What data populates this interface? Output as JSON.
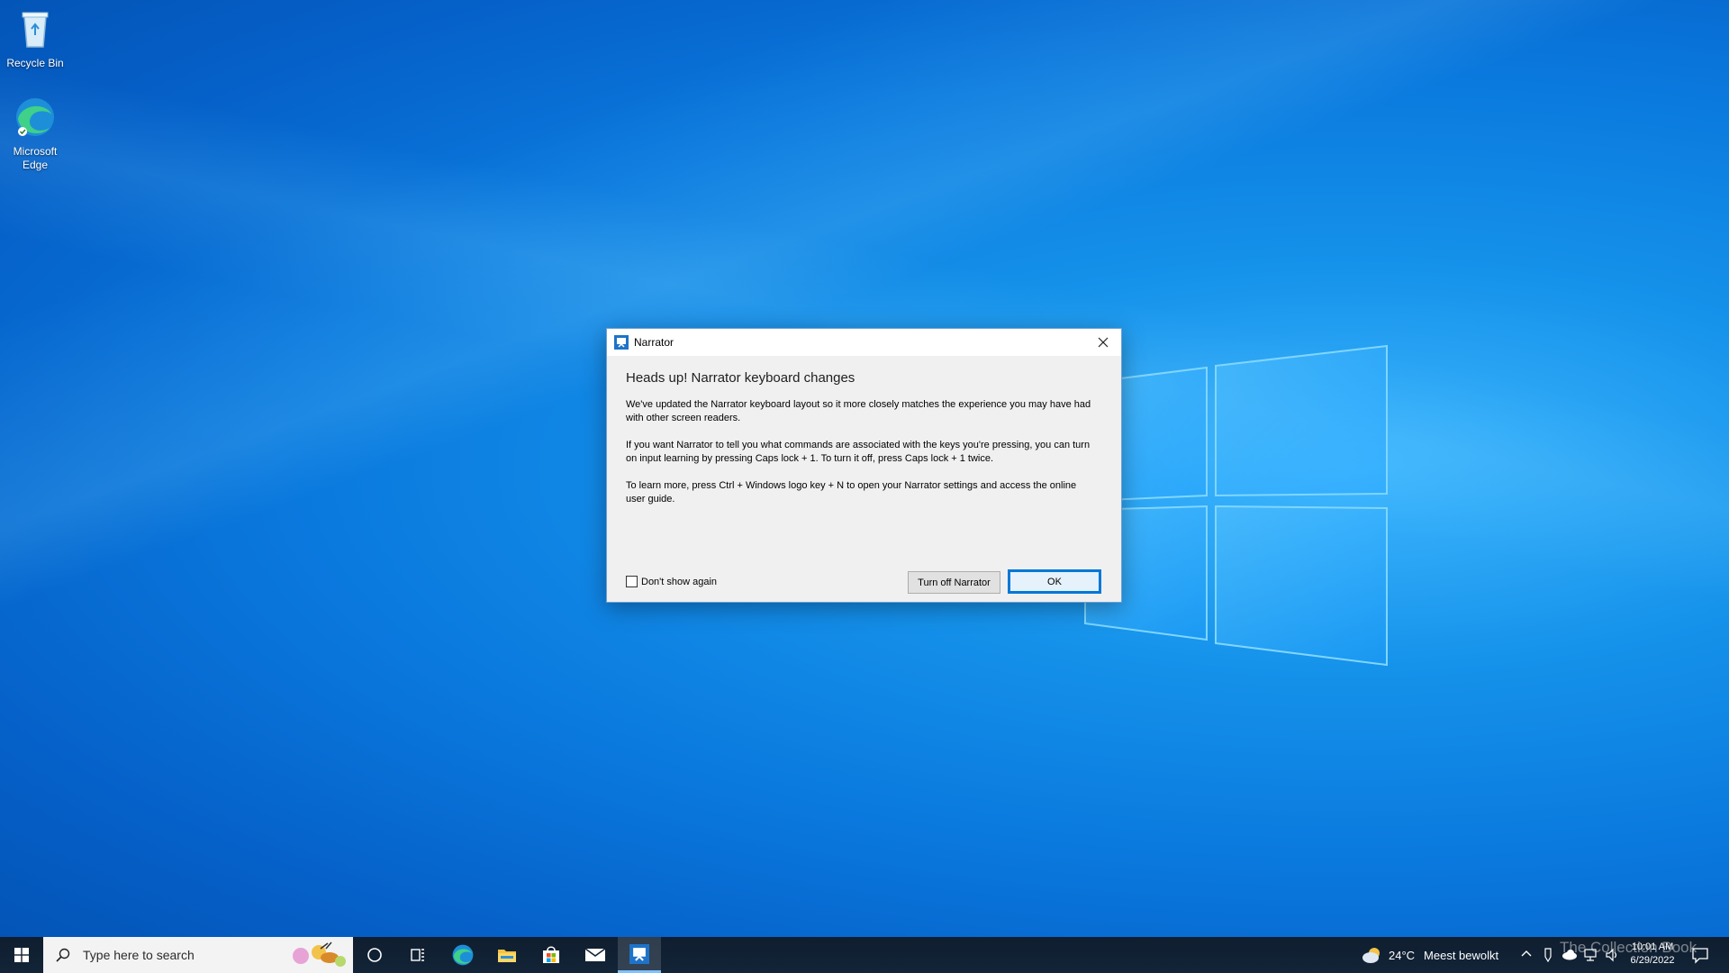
{
  "desktop": {
    "icons": [
      {
        "label": "Recycle Bin"
      },
      {
        "label": "Microsoft Edge"
      }
    ]
  },
  "dialog": {
    "title": "Narrator",
    "heading": "Heads up! Narrator keyboard changes",
    "paragraphs": [
      "We've updated the Narrator keyboard layout so it more closely matches the experience you may have had with other screen readers.",
      "If you want Narrator to tell you what commands are associated with the keys you're pressing, you can turn on input learning by pressing Caps lock + 1. To turn it off, press Caps lock + 1 twice.",
      "To learn more, press Ctrl + Windows logo key + N to open your Narrator settings and access the online user guide."
    ],
    "checkbox_label": "Don't show again",
    "checkbox_checked": false,
    "turn_off_label": "Turn off Narrator",
    "ok_label": "OK"
  },
  "taskbar": {
    "search_placeholder": "Type here to search",
    "weather_temp": "24°C",
    "weather_text": "Meest bewolkt",
    "time": "10:01 AM",
    "date": "6/29/2022",
    "pinned_icons": [
      "cortana-icon",
      "task-view-icon",
      "edge-icon",
      "file-explorer-icon",
      "store-icon",
      "mail-icon",
      "narrator-icon"
    ]
  },
  "watermark": "The Collection Book",
  "colors": {
    "accent": "#0078d7",
    "taskbar": "#132438",
    "desktop": "#0a79de"
  }
}
